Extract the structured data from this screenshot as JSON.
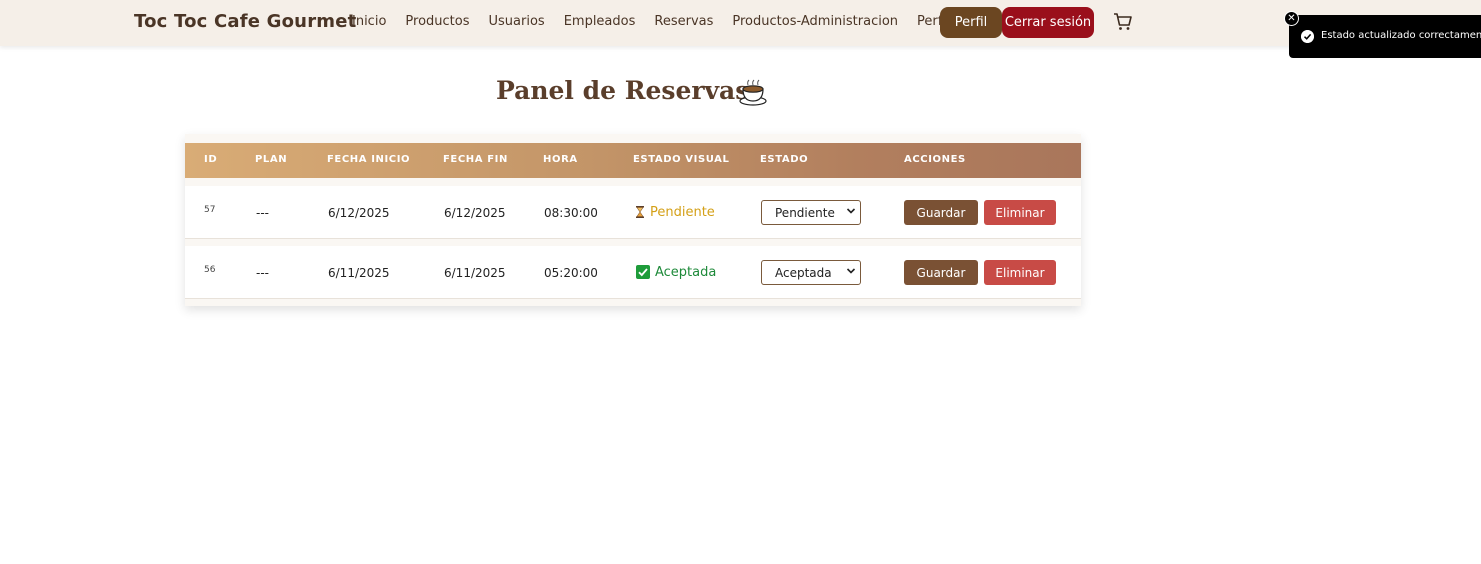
{
  "brand": "Toc Toc Cafe Gourmet",
  "nav": [
    "Inicio",
    "Productos",
    "Usuarios",
    "Empleados",
    "Reservas",
    "Productos-Administracion",
    "Perfil"
  ],
  "header_buttons": {
    "perfil": "Perfil",
    "logout": "Cerrar sesión"
  },
  "toast": {
    "message": "Estado actualizado correctamente."
  },
  "page_title": "Panel de Reservas",
  "table": {
    "headers": [
      "ID",
      "PLAN",
      "FECHA INICIO",
      "FECHA FIN",
      "HORA",
      "ESTADO VISUAL",
      "ESTADO",
      "ACCIONES"
    ],
    "rows": [
      {
        "id": "57",
        "plan": "---",
        "fecha_inicio": "6/12/2025",
        "fecha_fin": "6/12/2025",
        "hora": "08:30:00",
        "estado_visual": "Pendiente",
        "estado": "Pendiente",
        "save": "Guardar",
        "delete": "Eliminar"
      },
      {
        "id": "56",
        "plan": "---",
        "fecha_inicio": "6/11/2025",
        "fecha_fin": "6/11/2025",
        "hora": "05:20:00",
        "estado_visual": "Aceptada",
        "estado": "Aceptada",
        "save": "Guardar",
        "delete": "Eliminar"
      }
    ]
  },
  "colors": {
    "pendiente": "#d4a017",
    "aceptada": "#1e8a3a",
    "perfil_btn": "#6b4621",
    "logout_btn": "#9a0f1b",
    "save_btn": "#7a5134",
    "delete_btn": "#c84b46"
  }
}
